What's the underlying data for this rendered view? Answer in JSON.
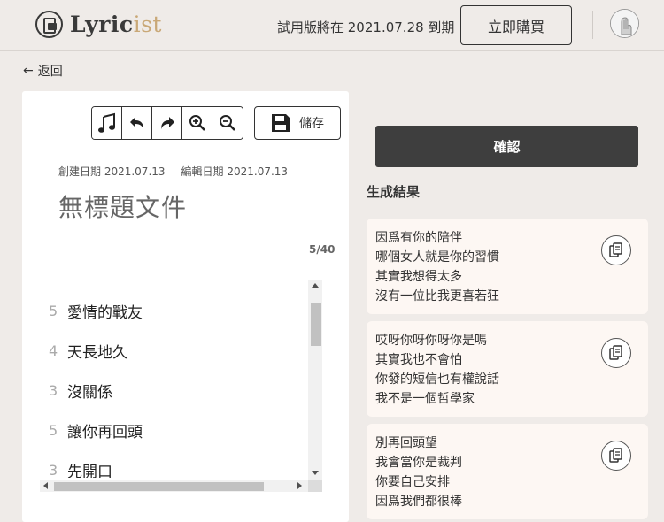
{
  "header": {
    "logo_main": "Lyric",
    "logo_accent": "ist",
    "trial_notice": "試用版將在 2021.07.28 到期",
    "buy_label": "立即購買"
  },
  "nav": {
    "back_label": "返回"
  },
  "editor": {
    "toolbar": {
      "icons": [
        "music-note-icon",
        "undo-icon",
        "redo-icon",
        "zoom-in-icon",
        "zoom-out-icon"
      ],
      "save_label": "儲存"
    },
    "created_date": "創建日期 2021.07.13",
    "edited_date": "編輯日期 2021.07.13",
    "doc_title": "無標題文件",
    "counter": "5/40",
    "lyrics": [
      {
        "num": "5",
        "text": "愛情的戰友"
      },
      {
        "num": "4",
        "text": "天長地久"
      },
      {
        "num": "3",
        "text": "沒關係"
      },
      {
        "num": "5",
        "text": "讓你再回頭"
      },
      {
        "num": "3",
        "text": "先開口"
      }
    ]
  },
  "actions": {
    "confirm_label": "確認"
  },
  "results": {
    "title": "生成結果",
    "cards": [
      {
        "lines": [
          "因爲有你的陪伴",
          "哪個女人就是你的習慣",
          "其實我想得太多",
          "沒有一位比我更喜若狂"
        ]
      },
      {
        "lines": [
          "哎呀你呀你呀你是嗎",
          "其實我也不會怕",
          "你發的短信也有權說話",
          "我不是一個哲學家"
        ]
      },
      {
        "lines": [
          "別再回頭望",
          "我會當你是裁判",
          "你要自己安排",
          "因爲我們都很棒"
        ]
      }
    ]
  },
  "colors": {
    "background": "#efebe8",
    "accent": "#c9a877",
    "primary_dark": "#3e3e3e",
    "card_bg": "#fdf7f3"
  }
}
